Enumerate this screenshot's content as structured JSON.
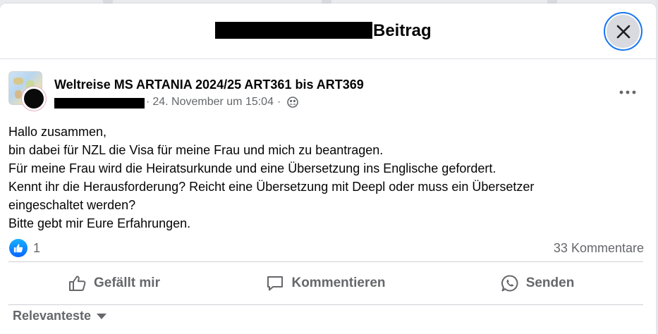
{
  "modal": {
    "title_suffix": "Beitrag",
    "close_icon": "close-icon"
  },
  "post": {
    "group_name": "Weltreise MS ARTANIA 2024/25 ART361 bis ART369",
    "timestamp": "24. November um 15:04",
    "separator": "·",
    "audience_icon": "members-icon",
    "more_icon": "more-options-icon",
    "body_lines": [
      "Hallo zusammen,",
      "bin dabei für NZL die Visa für meine Frau und mich zu beantragen.",
      "Für meine Frau wird die Heiratsurkunde und eine Übersetzung ins Englische gefordert.",
      "Kennt ihr die Herausforderung? Reicht eine Übersetzung mit Deepl oder muss ein Übersetzer eingeschaltet werden?",
      "Bitte gebt mir Eure Erfahrungen."
    ]
  },
  "reactions": {
    "like_count": "1",
    "comment_count": "33 Kommentare",
    "like_color": "#0866ff"
  },
  "actions": {
    "like": "Gefällt mir",
    "comment": "Kommentieren",
    "share": "Senden"
  },
  "comments": {
    "sort_label": "Relevanteste"
  }
}
